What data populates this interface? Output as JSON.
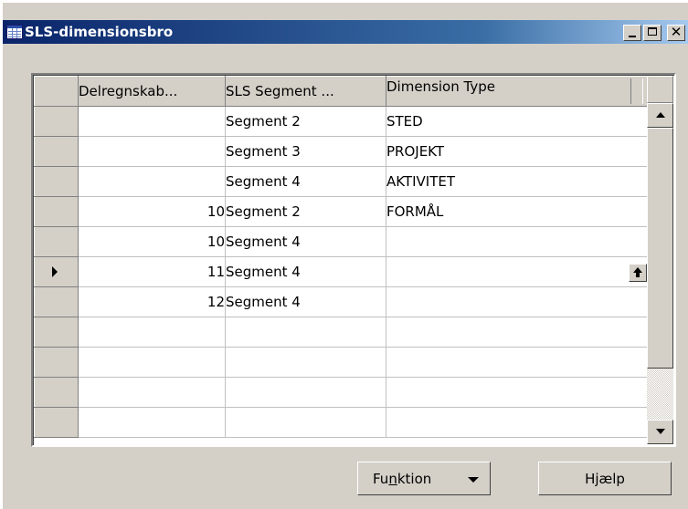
{
  "window": {
    "title": "SLS-dimensionsbro"
  },
  "grid": {
    "columns": [
      "Delregnskab...",
      "SLS Segment ...",
      "Dimension Type"
    ],
    "rows": [
      {
        "delregnskab": "",
        "segment": "Segment 2",
        "dimension_type": "STED"
      },
      {
        "delregnskab": "",
        "segment": "Segment 3",
        "dimension_type": "PROJEKT"
      },
      {
        "delregnskab": "",
        "segment": "Segment 4",
        "dimension_type": "AKTIVITET"
      },
      {
        "delregnskab": "10",
        "segment": "Segment 2",
        "dimension_type": "FORMÅL"
      },
      {
        "delregnskab": "10",
        "segment": "Segment 4",
        "dimension_type": ""
      },
      {
        "delregnskab": "11",
        "segment": "Segment 4",
        "dimension_type": ""
      },
      {
        "delregnskab": "12",
        "segment": "Segment 4",
        "dimension_type": ""
      },
      {
        "delregnskab": "",
        "segment": "",
        "dimension_type": ""
      },
      {
        "delregnskab": "",
        "segment": "",
        "dimension_type": ""
      },
      {
        "delregnskab": "",
        "segment": "",
        "dimension_type": ""
      },
      {
        "delregnskab": "",
        "segment": "",
        "dimension_type": ""
      }
    ],
    "current_row_index": 5
  },
  "buttons": {
    "funktion_pre": "Fu",
    "funktion_underlined": "n",
    "funktion_post": "ktion",
    "hjaelp": "Hjælp"
  },
  "icons": {
    "window_icon": "table-icon",
    "current_row": "row-pointer-icon",
    "lookup": "lookup-up-arrow-icon"
  }
}
